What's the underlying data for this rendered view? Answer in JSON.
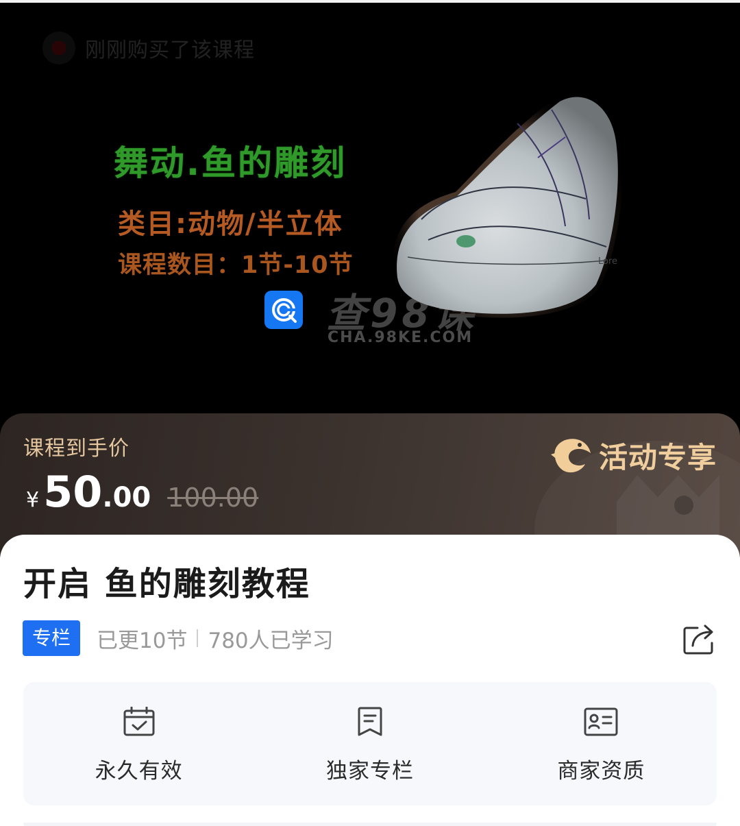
{
  "banner": {
    "toast_text": "刚刚购买了该课程",
    "title": "舞动.鱼的雕刻",
    "category": "类目:动物/半立体",
    "lesson_count": "课程数目：1节-10节",
    "watermark_text": "查98课",
    "watermark_url": "CHA.98KE.COM",
    "photo_label": "Lore"
  },
  "price": {
    "label": "课程到手价",
    "currency": "¥",
    "integer": "50",
    "decimal": ".00",
    "original": "100.00",
    "promo_text": "活动专享"
  },
  "course": {
    "title": "开启 鱼的雕刻教程",
    "tag": "专栏",
    "updated": "已更10节",
    "learners": "780人已学习"
  },
  "features": [
    {
      "label": "永久有效",
      "icon": "calendar-check-icon"
    },
    {
      "label": "独家专栏",
      "icon": "bookmark-icon"
    },
    {
      "label": "商家资质",
      "icon": "id-card-icon"
    }
  ],
  "colors": {
    "hero_title": "#2f9a2a",
    "hero_subtitle": "#b55a22",
    "price_label": "#e6c79f",
    "promo": "#f1cd99",
    "tag_bg": "#1f6ff2",
    "brand_blue": "#1677f2"
  }
}
